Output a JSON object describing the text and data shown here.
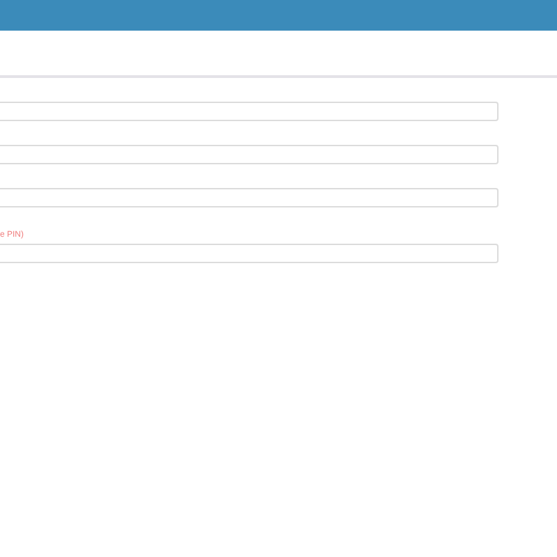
{
  "fields": [
    {
      "kind": "input"
    },
    {
      "kind": "input"
    },
    {
      "kind": "input"
    },
    {
      "kind": "input",
      "error": "e PIN)"
    }
  ]
}
